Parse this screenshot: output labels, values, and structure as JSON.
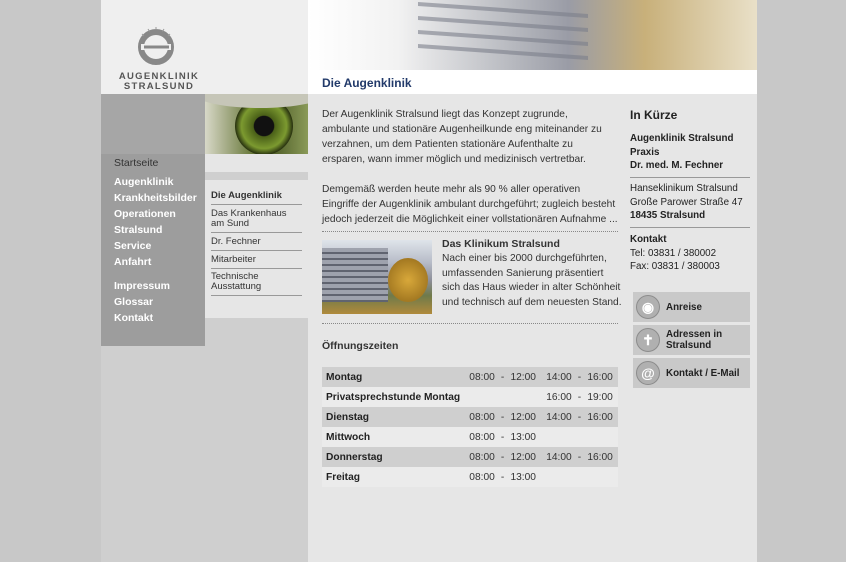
{
  "logo": {
    "line1": "AUGENKLINIK",
    "line2": "STRALSUND"
  },
  "page_title": "Die Augenklinik",
  "main_nav": {
    "start": "Startseite",
    "items": [
      "Augenklinik",
      "Krankheitsbilder",
      "Operationen",
      "Stralsund",
      "Service",
      "Anfahrt"
    ],
    "items2": [
      "Impressum",
      "Glossar",
      "Kontakt"
    ]
  },
  "sub_nav": {
    "items": [
      "Die Augenklinik",
      "Das Krankenhaus am Sund",
      "Dr. Fechner",
      "Mitarbeiter",
      "Technische Ausstattung"
    ]
  },
  "intro": {
    "p1": "Der Augenklinik Stralsund liegt das Konzept zugrunde, ambulante und stationäre Augenheilkunde eng miteinander zu verzahnen, um dem Patienten stationäre Aufenthalte zu ersparen, wann immer möglich und medizinisch vertretbar.",
    "p2": "Demgemäß werden heute mehr als 90 % aller operativen Eingriffe der Augenklinik ambulant durchgeführt; zugleich besteht jedoch jederzeit die Möglichkeit einer vollstationären Aufnahme ..."
  },
  "klinikum": {
    "title": "Das Klinikum Stralsund",
    "text": "Nach einer bis 2000 durchgeführten, umfassenden Sanierung präsentiert sich das Haus wieder in alter Schönheit und technisch auf dem neuesten Stand."
  },
  "hours": {
    "title": "Öffnungszeiten",
    "rows": [
      {
        "day": "Montag",
        "am_from": "08:00",
        "am_sep": "-",
        "am_to": "12:00",
        "pm_from": "14:00",
        "pm_sep": "-",
        "pm_to": "16:00"
      },
      {
        "day": "Privatsprechstunde Montag",
        "am_from": "",
        "am_sep": "",
        "am_to": "",
        "pm_from": "16:00",
        "pm_sep": "-",
        "pm_to": "19:00"
      },
      {
        "day": "Dienstag",
        "am_from": "08:00",
        "am_sep": "-",
        "am_to": "12:00",
        "pm_from": "14:00",
        "pm_sep": "-",
        "pm_to": "16:00"
      },
      {
        "day": "Mittwoch",
        "am_from": "08:00",
        "am_sep": "-",
        "am_to": "13:00",
        "pm_from": "",
        "pm_sep": "",
        "pm_to": ""
      },
      {
        "day": "Donnerstag",
        "am_from": "08:00",
        "am_sep": "-",
        "am_to": "12:00",
        "pm_from": "14:00",
        "pm_sep": "-",
        "pm_to": "16:00"
      },
      {
        "day": "Freitag",
        "am_from": "08:00",
        "am_sep": "-",
        "am_to": "13:00",
        "pm_from": "",
        "pm_sep": "",
        "pm_to": ""
      }
    ]
  },
  "sidebar": {
    "title": "In Kürze",
    "clinic_name": "Augenklinik Stralsund",
    "praxis": "Praxis",
    "doctor": "Dr. med. M. Fechner",
    "address1": "Hanseklinikum Stralsund",
    "address2": "Große Parower Straße 47",
    "city": "18435 Stralsund",
    "contact_title": "Kontakt",
    "tel": "Tel:  03831 / 380002",
    "fax": "Fax: 03831 / 380003",
    "buttons": [
      {
        "label": "Anreise",
        "icon": "location-pin-icon",
        "glyph": "◉"
      },
      {
        "label": "Adressen in Stralsund",
        "icon": "person-icon",
        "glyph": "✝"
      },
      {
        "label": "Kontakt / E-Mail",
        "icon": "at-sign-icon",
        "glyph": "@"
      }
    ]
  }
}
